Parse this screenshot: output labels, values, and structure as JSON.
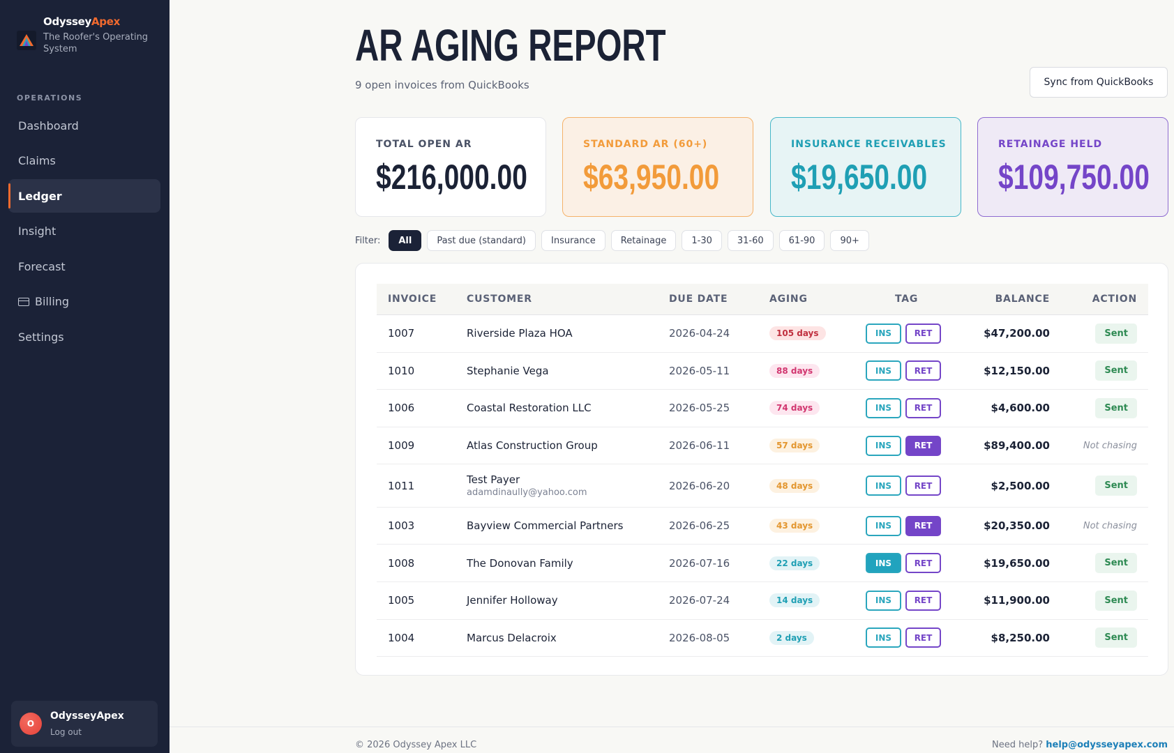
{
  "brand": {
    "name_part1": "Odyssey",
    "name_part2": "Apex",
    "tagline": "The Roofer's Operating System"
  },
  "sidebar": {
    "section_label": "OPERATIONS",
    "items": [
      {
        "label": "Dashboard"
      },
      {
        "label": "Claims"
      },
      {
        "label": "Ledger",
        "active": true
      },
      {
        "label": "Insight"
      },
      {
        "label": "Forecast"
      },
      {
        "label": "Billing",
        "icon": "credit-card-icon"
      },
      {
        "label": "Settings"
      }
    ],
    "user": {
      "avatar_initial": "O",
      "name": "OdysseyApex",
      "logout_label": "Log out"
    }
  },
  "header": {
    "title": "AR AGING REPORT",
    "subtitle": "9 open invoices from QuickBooks",
    "sync_button": "Sync from QuickBooks"
  },
  "summary": {
    "total": {
      "label": "TOTAL OPEN AR",
      "value": "$216,000.00"
    },
    "standard": {
      "label": "STANDARD AR (60+)",
      "value": "$63,950.00"
    },
    "insurance": {
      "label": "INSURANCE RECEIVABLES",
      "value": "$19,650.00"
    },
    "retainage": {
      "label": "RETAINAGE HELD",
      "value": "$109,750.00"
    }
  },
  "filters": {
    "label": "Filter:",
    "options": [
      "All",
      "Past due (standard)",
      "Insurance",
      "Retainage",
      "1-30",
      "31-60",
      "61-90",
      "90+"
    ],
    "active": "All"
  },
  "table": {
    "columns": {
      "invoice": "INVOICE",
      "customer": "CUSTOMER",
      "due_date": "DUE DATE",
      "aging": "AGING",
      "tag": "TAG",
      "balance": "BALANCE",
      "action": "ACTION"
    },
    "tag_labels": {
      "ins": "INS",
      "ret": "RET"
    },
    "rows": [
      {
        "invoice": "1007",
        "customer": "Riverside Plaza HOA",
        "email": "",
        "due": "2026-04-24",
        "aging": "105 days",
        "aging_color": "#c0303f",
        "aging_bg": "#fde4e4",
        "ins": false,
        "ret": false,
        "balance": "$47,200.00",
        "action": "Sent"
      },
      {
        "invoice": "1010",
        "customer": "Stephanie Vega",
        "email": "",
        "due": "2026-05-11",
        "aging": "88 days",
        "aging_color": "#d1366f",
        "aging_bg": "#fde6ef",
        "ins": false,
        "ret": false,
        "balance": "$12,150.00",
        "action": "Sent"
      },
      {
        "invoice": "1006",
        "customer": "Coastal Restoration LLC",
        "email": "",
        "due": "2026-05-25",
        "aging": "74 days",
        "aging_color": "#d1366f",
        "aging_bg": "#fde6ef",
        "ins": false,
        "ret": false,
        "balance": "$4,600.00",
        "action": "Sent"
      },
      {
        "invoice": "1009",
        "customer": "Atlas Construction Group",
        "email": "",
        "due": "2026-06-11",
        "aging": "57 days",
        "aging_color": "#e3962f",
        "aging_bg": "#fdf1e0",
        "ins": false,
        "ret": true,
        "balance": "$89,400.00",
        "action": "Not chasing"
      },
      {
        "invoice": "1011",
        "customer": "Test Payer",
        "email": "adamdinaully@yahoo.com",
        "due": "2026-06-20",
        "aging": "48 days",
        "aging_color": "#e3962f",
        "aging_bg": "#fdf1e0",
        "ins": false,
        "ret": false,
        "balance": "$2,500.00",
        "action": "Sent"
      },
      {
        "invoice": "1003",
        "customer": "Bayview Commercial Partners",
        "email": "",
        "due": "2026-06-25",
        "aging": "43 days",
        "aging_color": "#e3962f",
        "aging_bg": "#fdf1e0",
        "ins": false,
        "ret": true,
        "balance": "$20,350.00",
        "action": "Not chasing"
      },
      {
        "invoice": "1008",
        "customer": "The Donovan Family",
        "email": "",
        "due": "2026-07-16",
        "aging": "22 days",
        "aging_color": "#1f9fb4",
        "aging_bg": "#e2f3f6",
        "ins": true,
        "ret": false,
        "balance": "$19,650.00",
        "action": "Sent"
      },
      {
        "invoice": "1005",
        "customer": "Jennifer Holloway",
        "email": "",
        "due": "2026-07-24",
        "aging": "14 days",
        "aging_color": "#1f9fb4",
        "aging_bg": "#e2f3f6",
        "ins": false,
        "ret": false,
        "balance": "$11,900.00",
        "action": "Sent"
      },
      {
        "invoice": "1004",
        "customer": "Marcus Delacroix",
        "email": "",
        "due": "2026-08-05",
        "aging": "2 days",
        "aging_color": "#1f9fb4",
        "aging_bg": "#e2f3f6",
        "ins": false,
        "ret": false,
        "balance": "$8,250.00",
        "action": "Sent"
      }
    ]
  },
  "footer": {
    "copyright": "© 2026 Odyssey Apex LLC",
    "help_text": "Need help?",
    "help_email": "help@odysseyapex.com"
  }
}
